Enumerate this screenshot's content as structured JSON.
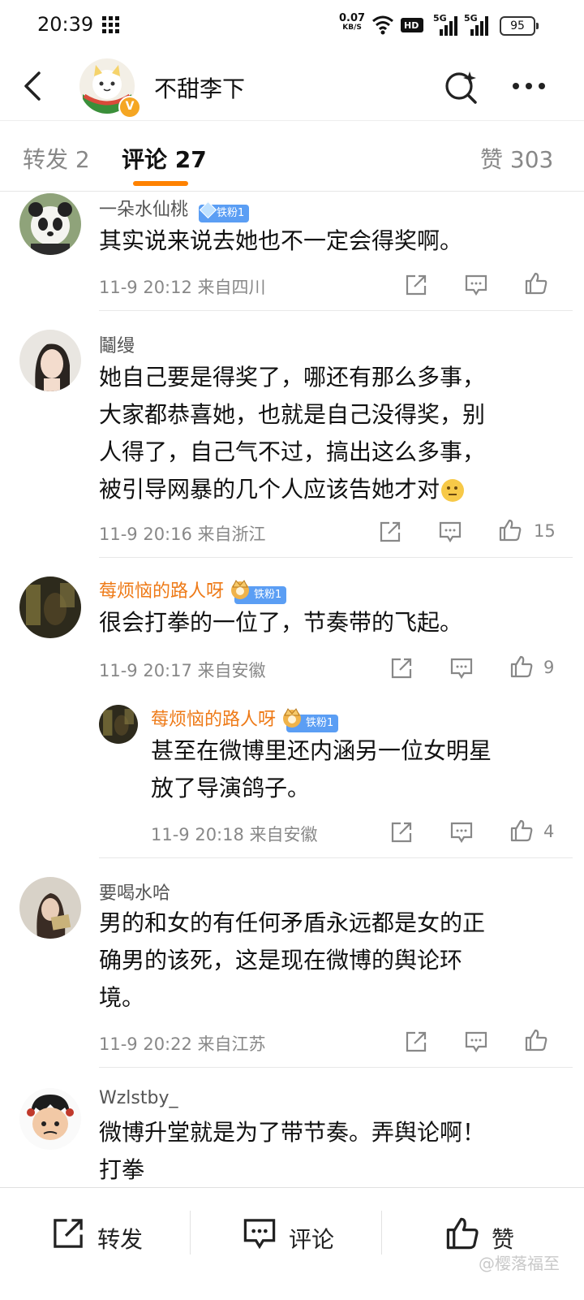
{
  "status_bar": {
    "time": "20:39",
    "speed_value": "0.07",
    "speed_unit": "KB/S",
    "hd_label": "HD",
    "signal1_label": "5G",
    "signal2_label": "5G",
    "battery": "95"
  },
  "header": {
    "title": "不甜李下",
    "verified_badge": "V"
  },
  "tabs": {
    "repost": "转发 2",
    "comments": "评论 27",
    "likes": "赞 303"
  },
  "comments": [
    {
      "name": "一朵水仙桃",
      "fan_badge": "铁粉1",
      "text": "其实说来说去她也不一定会得奖啊。",
      "meta": "11-9 20:12  来自四川",
      "likes": ""
    },
    {
      "name": "鬮缦",
      "fan_badge": "",
      "text_lines": [
        "她自己要是得奖了，哪还有那么多事，",
        "大家都恭喜她，也就是自己没得奖，别",
        "人得了，自己气不过，搞出这么多事，",
        "被引导网暴的几个人应该告她才对"
      ],
      "meta": "11-9 20:16  来自浙江",
      "likes": "15"
    },
    {
      "name": "莓烦恼的路人呀",
      "fan_badge": "铁粉1",
      "text": "很会打拳的一位了，节奏带的飞起。",
      "meta": "11-9 20:17  来自安徽",
      "likes": "9"
    },
    {
      "name": "莓烦恼的路人呀",
      "fan_badge": "铁粉1",
      "text_lines": [
        "甚至在微博里还内涵另一位女明星",
        "放了导演鸽子。"
      ],
      "meta": "11-9 20:18  来自安徽",
      "likes": "4"
    },
    {
      "name": "要喝水哈",
      "fan_badge": "",
      "text_lines": [
        "男的和女的有任何矛盾永远都是女的正",
        "确男的该死，这是现在微博的舆论环",
        "境。"
      ],
      "meta": "11-9 20:22  来自江苏",
      "likes": ""
    },
    {
      "name": "Wzlstby_",
      "fan_badge": "",
      "text_lines": [
        "微博升堂就是为了带节奏。弄舆论啊！",
        "打拳"
      ]
    }
  ],
  "bottom_bar": {
    "repost": "转发",
    "comment": "评论",
    "like": "赞"
  },
  "watermark": "@樱落福至",
  "colors": {
    "accent": "#ff8200",
    "orange_name": "#ee7a17",
    "fan_badge": "#5b9ef4",
    "meta_gray": "#888888"
  }
}
